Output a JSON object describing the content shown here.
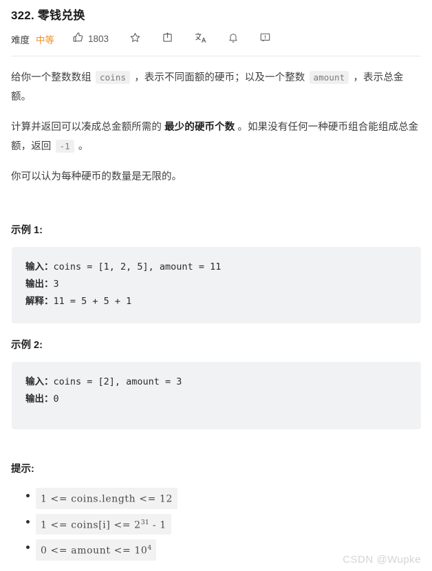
{
  "header": {
    "title": "322. 零钱兑换",
    "difficulty_label": "难度",
    "difficulty_value": "中等",
    "difficulty_color": "#ef9025",
    "like_count": "1803",
    "icons": [
      {
        "name": "thumbs-up-icon",
        "label": "点赞"
      },
      {
        "name": "star-icon",
        "label": "收藏"
      },
      {
        "name": "share-icon",
        "label": "分享"
      },
      {
        "name": "translate-icon",
        "label": "切换语言"
      },
      {
        "name": "bell-icon",
        "label": "订阅"
      },
      {
        "name": "feedback-icon",
        "label": "反馈"
      }
    ]
  },
  "description": {
    "p1_a": "给你一个整数数组 ",
    "p1_code1": "coins",
    "p1_b": " ，表示不同面额的硬币；以及一个整数 ",
    "p1_code2": "amount",
    "p1_c": " ，表示总金额。",
    "p2_a": "计算并返回可以凑成总金额所需的 ",
    "p2_bold": "最少的硬币个数",
    "p2_b": " 。如果没有任何一种硬币组合能组成总金额，返回 ",
    "p2_code": "-1",
    "p2_c": " 。",
    "p3": "你可以认为每种硬币的数量是无限的。"
  },
  "examples": [
    {
      "heading": "示例 1:",
      "lines": [
        {
          "label": "输入：",
          "value": "coins = [1, 2, 5], amount = 11"
        },
        {
          "label": "输出：",
          "value": "3"
        },
        {
          "label": "解释：",
          "value": "11 = 5 + 5 + 1"
        }
      ]
    },
    {
      "heading": "示例 2:",
      "lines": [
        {
          "label": "输入：",
          "value": "coins = [2], amount = 3"
        },
        {
          "label": "输出：",
          "value": "0"
        }
      ]
    }
  ],
  "hints": {
    "heading": "提示:",
    "items": [
      {
        "base": "1 <= coins.length <= 12",
        "sup": "",
        "tail": ""
      },
      {
        "base": "1 <= coins[i] <= 2",
        "sup": "31",
        "tail": " - 1"
      },
      {
        "base": "0 <= amount <= 10",
        "sup": "4",
        "tail": ""
      }
    ]
  },
  "watermark": "CSDN @Wupke"
}
